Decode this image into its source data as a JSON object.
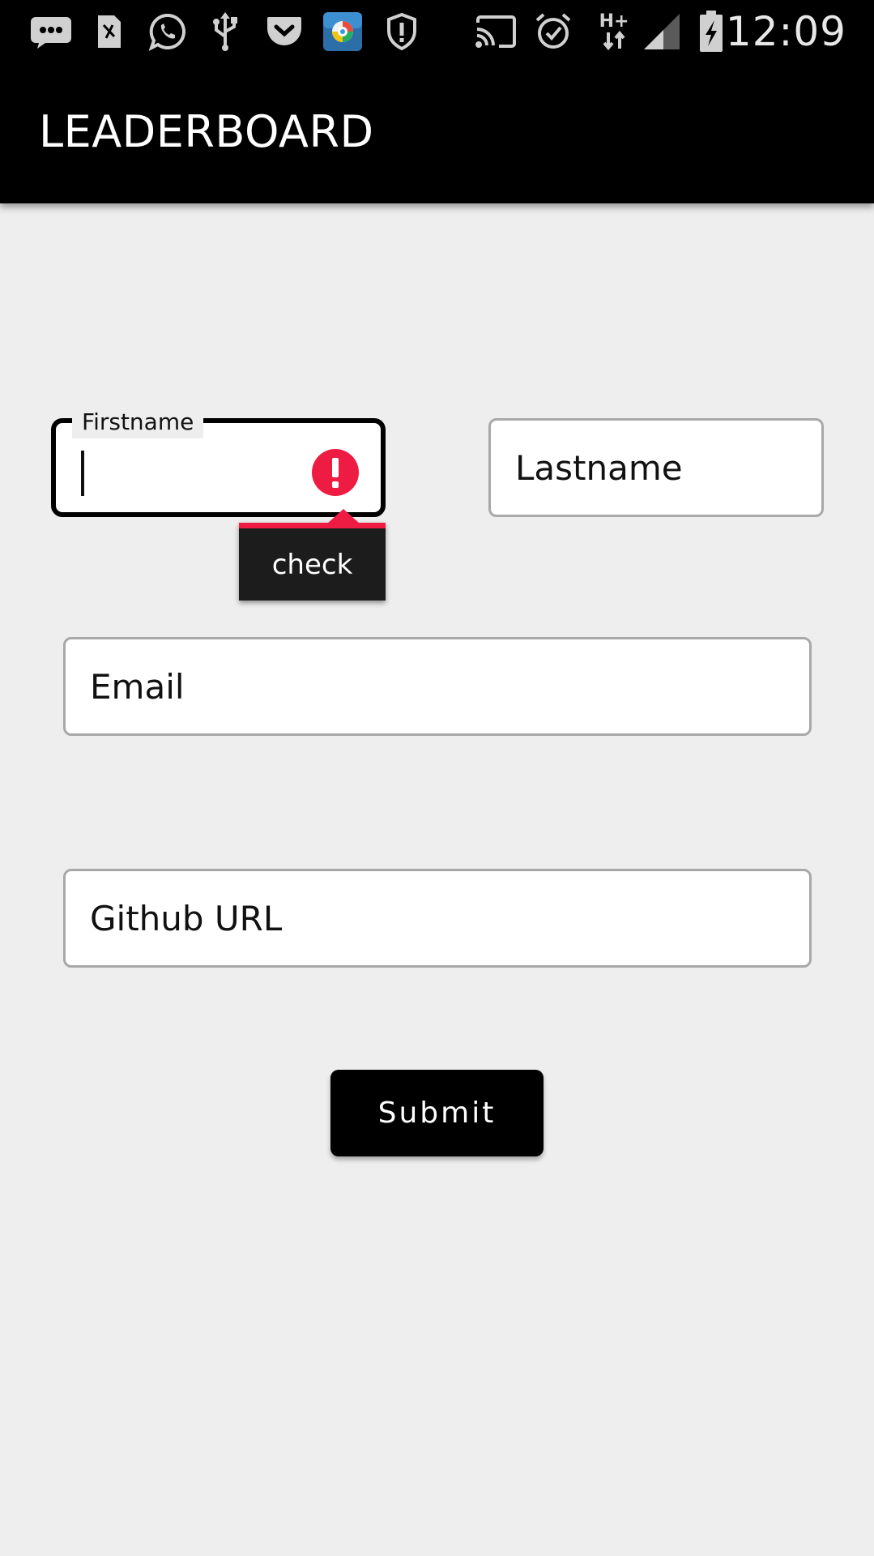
{
  "status_bar": {
    "time": "12:09",
    "network_type": "H+",
    "icons": [
      "messages-icon",
      "sim-card-icon",
      "whatsapp-icon",
      "usb-icon",
      "pocket-icon",
      "launcher-app-icon",
      "shield-icon",
      "cast-icon",
      "alarm-icon",
      "network-data-icon",
      "signal-icon",
      "battery-charging-icon"
    ]
  },
  "app_bar": {
    "title": "LEADERBOARD"
  },
  "form": {
    "firstname": {
      "label": "Firstname",
      "value": "",
      "error_tooltip": "check"
    },
    "lastname": {
      "placeholder": "Lastname"
    },
    "email": {
      "placeholder": "Email"
    },
    "github": {
      "placeholder": "Github URL"
    },
    "submit_label": "Submit"
  },
  "colors": {
    "app_bar": "#000000",
    "background": "#eeeeee",
    "error": "#ee1c43",
    "tooltip": "#1c1c1c"
  }
}
